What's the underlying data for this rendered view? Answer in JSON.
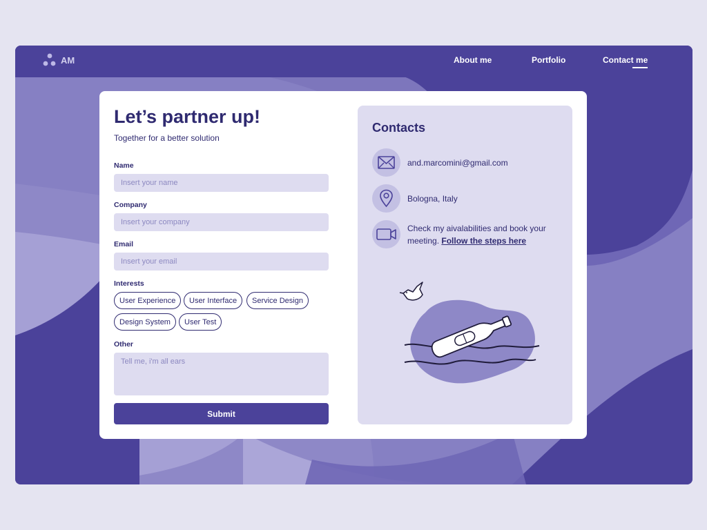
{
  "header": {
    "logo_text": "AM",
    "nav": {
      "about": "About me",
      "portfolio": "Portfolio",
      "contact": "Contact me"
    }
  },
  "form": {
    "title": "Let’s partner up!",
    "subtitle": "Together for a better solution",
    "name_label": "Name",
    "name_placeholder": "Insert your name",
    "company_label": "Company",
    "company_placeholder": "Insert your company",
    "email_label": "Email",
    "email_placeholder": "Insert your email",
    "interests_label": "Interests",
    "interests": [
      "User Experience",
      "User Interface",
      "Service Design",
      "Design System",
      "User Test"
    ],
    "other_label": "Other",
    "other_placeholder": "Tell me, i'm all ears",
    "submit_label": "Submit"
  },
  "contacts": {
    "title": "Contacts",
    "email": "and.marcomini@gmail.com",
    "location": "Bologna, Italy",
    "meeting_text": "Check my aivalabilities and book your meeting.",
    "meeting_link": "Follow the steps here"
  },
  "colors": {
    "brand": "#4b429a",
    "dark_text": "#2f2a70",
    "field_bg": "#dedcf0",
    "page_bg": "#e5e4f1"
  },
  "icons": [
    "logo-dots-icon",
    "mail-icon",
    "location-pin-icon",
    "video-camera-icon"
  ]
}
